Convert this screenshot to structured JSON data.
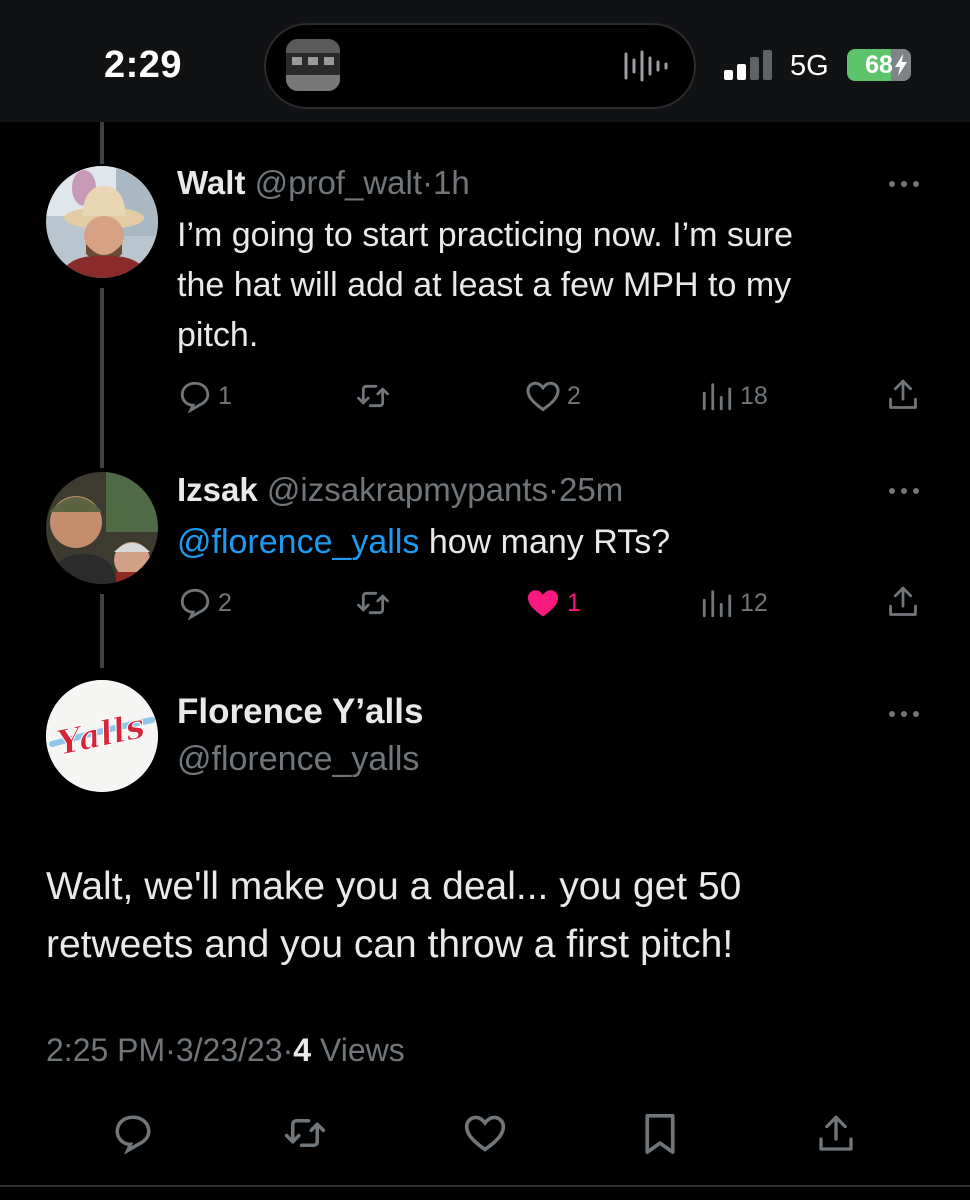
{
  "status_bar": {
    "time": "2:29",
    "network": "5G",
    "battery": "68"
  },
  "colors": {
    "background": "#000000",
    "text": "#e7e9ea",
    "muted": "#71767b",
    "accent": "#1d9bf0",
    "like": "#f91880",
    "battery": "#5ec46b"
  },
  "tweets": [
    {
      "name": "Walt",
      "handle": "@prof_walt",
      "separator": "·",
      "time": "1h",
      "lines": [
        "I’m going to start practicing now. I’m sure",
        "the hat will add at least a few MPH to my",
        "pitch."
      ],
      "replies": "1",
      "likes": "2",
      "views": "18"
    },
    {
      "name": "Izsak",
      "handle": "@izsakrapmypants",
      "separator": "·",
      "time": "25m",
      "mention": "@florence_yalls",
      "text": " how many RTs?",
      "replies": "2",
      "likes": "1",
      "views": "12"
    }
  ],
  "main_tweet": {
    "name": "Florence Y’alls",
    "handle": "@florence_yalls",
    "avatar_logo": "Yalls",
    "lines": [
      "Walt, we'll make you a deal... you get 50",
      "retweets and you can throw a first pitch!"
    ],
    "time": "2:25 PM",
    "date": "3/23/23",
    "separator": "·",
    "views_count": "4",
    "views_label": " Views"
  },
  "icons": [
    "reply-icon",
    "retweet-icon",
    "like-icon",
    "views-icon",
    "share-icon",
    "bookmark-icon",
    "more-icon"
  ]
}
